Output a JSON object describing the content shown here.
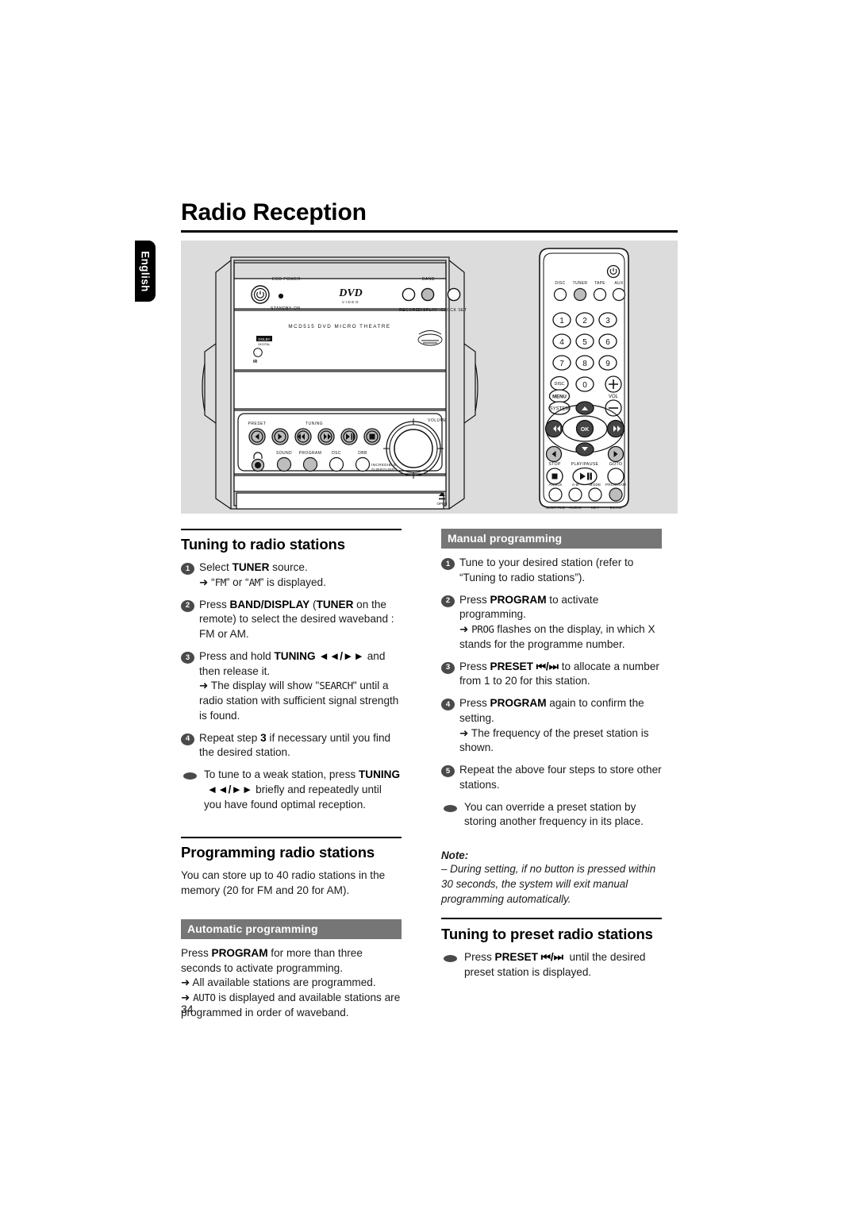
{
  "page": {
    "title": "Radio Reception",
    "language_tab": "English",
    "page_number": "34",
    "accent_bar_color": "#767676",
    "illustration_bg": "#dcdcdc"
  },
  "illustration": {
    "system": {
      "model_label": "MCD515 DVD MICRO THEATRE",
      "eco_power": "ECO POWER",
      "standby_on": "STANDBY·ON",
      "dvd_logo": "DVD",
      "dvd_logo_sub": "VIDEO",
      "record": "RECORD",
      "band": "BAND",
      "display": "DISPLAY",
      "clock_set": "CLOCK SET",
      "ir": "IR",
      "dolby_logo": "DOLBY DIGITAL",
      "preset": "PRESET",
      "tuning": "TUNING",
      "volume": "VOLUME",
      "sound": "SOUND",
      "program": "PROGRAM",
      "dsc": "DSC",
      "dbb": "DBB",
      "incredible_surround_l1": "INCREDIBLE",
      "incredible_surround_l2": "SURROUND",
      "open": "OPEN"
    },
    "remote": {
      "sources": [
        "DISC",
        "TUNER",
        "TAPE",
        "AUX"
      ],
      "keypad": [
        "1",
        "2",
        "3",
        "4",
        "5",
        "6",
        "7",
        "8",
        "9"
      ],
      "zero": "0",
      "disc_menu_l1": "DISC",
      "disc_menu_l2": "MENU",
      "system_menu": "SYSTEM",
      "vol": "VOL",
      "vol_plus": "+",
      "vol_minus": "–",
      "ok": "OK",
      "stop": "STOP",
      "play_pause": "PLAY/PAUSE",
      "goto": "GOTO",
      "row_angle": [
        "ANGLE",
        "A-B",
        "MODE",
        "PROGRAM"
      ],
      "row_subtitle": [
        "SUBTITLE",
        "AUDIO",
        "KEY",
        "ECHO"
      ]
    }
  },
  "tuning_section": {
    "heading": "Tuning to radio stations",
    "steps": [
      {
        "marker": "1",
        "text_parts": [
          {
            "t": "Select "
          },
          {
            "t": "TUNER",
            "b": true
          },
          {
            "t": " source."
          }
        ],
        "sub": "➜ “FM” or “AM” is displayed.",
        "sub_lcd": [
          "FM",
          "AM"
        ]
      },
      {
        "marker": "2",
        "text": "Press BAND/DISPLAY (TUNER on the remote) to select the desired waveband : FM or AM."
      },
      {
        "marker": "3",
        "text": "Press and hold TUNING ◄◄/►► and then release it.",
        "sub": "➜ The display will show \"SEARCH\" until a radio station with sufficient signal strength is found."
      },
      {
        "marker": "4",
        "text": "Repeat step 3 if necessary until you find the desired station."
      },
      {
        "marker": "•",
        "text": "To tune to a weak station, press TUNING ◄◄/►► briefly and repeatedly until you have found optimal reception."
      }
    ]
  },
  "programming_section": {
    "heading": "Programming radio stations",
    "intro": "You can store up to 40 radio stations in the memory (20 for FM and 20 for AM).",
    "automatic": {
      "bar_label": "Automatic programming",
      "body": "Press PROGRAM for more than three seconds to activate programming.",
      "results": [
        "➜ All available stations are programmed.",
        "➜ AUTO is displayed and available stations are programmed in order of waveband."
      ],
      "lcd_word": "AUTO"
    }
  },
  "manual_section": {
    "bar_label": "Manual programming",
    "steps": [
      {
        "marker": "1",
        "text": "Tune to your desired station (refer to “Tuning to radio stations”)."
      },
      {
        "marker": "2",
        "text": "Press PROGRAM to activate programming.",
        "sub": "➜ PROG flashes on the display, in which X stands for the programme number.",
        "lcd_word": "PROG"
      },
      {
        "marker": "3",
        "text": "Press PRESET ⏮/⏭ to allocate a number from 1 to 20 for this station."
      },
      {
        "marker": "4",
        "text": "Press PROGRAM again to confirm the setting.",
        "sub": "➜ The frequency of the preset station is shown."
      },
      {
        "marker": "5",
        "text": "Repeat the above four steps to store other stations."
      },
      {
        "marker": "•",
        "text": "You can override a preset station by storing another frequency in its place."
      }
    ],
    "note_heading": "Note:",
    "note_body": "–  During setting, if no button is pressed within 30 seconds, the system will exit manual programming automatically."
  },
  "preset_section": {
    "heading": "Tuning to preset radio stations",
    "bullet": "Press PRESET ⏮/⏭ until the desired preset station is displayed."
  }
}
